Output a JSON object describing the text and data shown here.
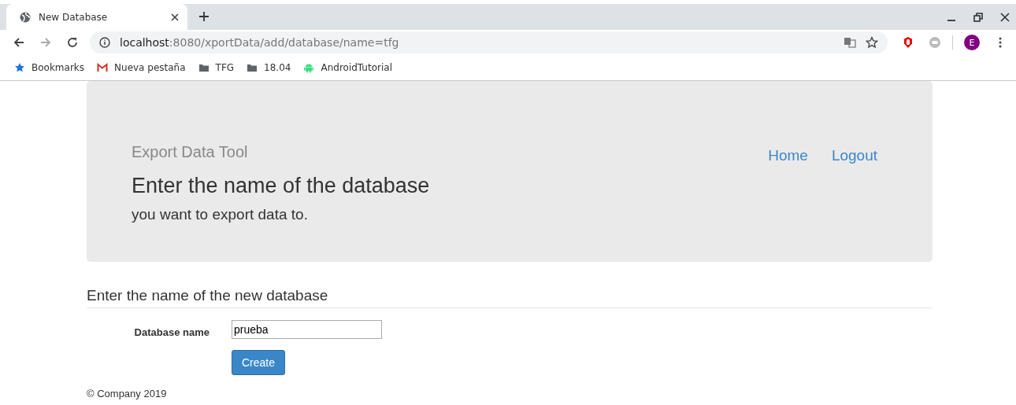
{
  "browser": {
    "tab": {
      "title": "New Database",
      "selected": true
    },
    "url": {
      "host": "localhost",
      "path": ":8080/xportData/add/database/name=tfg"
    },
    "profile": "E",
    "bookmarks": [
      {
        "label": "Bookmarks",
        "kind": "star"
      },
      {
        "label": "Nueva pestaña",
        "kind": "gmail"
      },
      {
        "label": "TFG",
        "kind": "folder"
      },
      {
        "label": "18.04",
        "kind": "folder"
      },
      {
        "label": "AndroidTutorial",
        "kind": "android"
      }
    ]
  },
  "header": {
    "brand": "Export Data Tool",
    "title": "Enter the name of the database",
    "subtitle": "you want to export data to.",
    "nav": [
      "Home",
      "Logout"
    ]
  },
  "form": {
    "heading": "Enter the name of the new database",
    "label": "Database name",
    "value": "prueba",
    "button": "Create"
  },
  "footer": "© Company 2019"
}
